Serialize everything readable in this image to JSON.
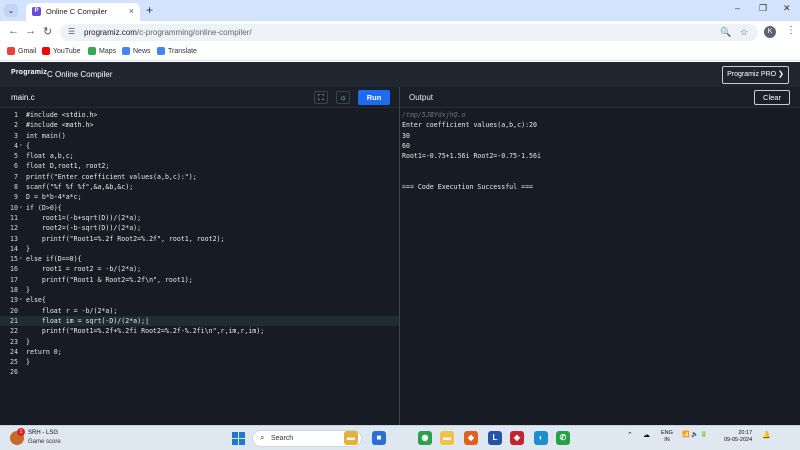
{
  "browser": {
    "tab_menu_icon": "chevron-down-icon",
    "tab_title": "Online C Compiler",
    "tab_close": "×",
    "new_tab": "+",
    "window_controls": [
      "–",
      "❐",
      "✕"
    ],
    "back": "←",
    "forward": "→",
    "reload": "↻",
    "url_host": "programiz.com",
    "url_path": "/c-programming/online-compiler/",
    "zoom_icon": "🔍",
    "star_icon": "☆",
    "profile_letter": "K",
    "menu_icon": "⋮",
    "bookmarks": [
      {
        "label": "Gmail",
        "color": "#ea4335"
      },
      {
        "label": "YouTube",
        "color": "#ff0000"
      },
      {
        "label": "Maps",
        "color": "#34a853"
      },
      {
        "label": "News",
        "color": "#4285f4"
      },
      {
        "label": "Translate",
        "color": "#4285f4"
      }
    ]
  },
  "site": {
    "logo": "Programiz",
    "title": "C Online Compiler",
    "pro_button": "Programiz PRO ❯"
  },
  "editor": {
    "file_tab": "main.c",
    "fullscreen_icon": "⛶",
    "theme_icon": "☼",
    "run_label": "Run",
    "active_line": 21,
    "lines": [
      {
        "n": "1",
        "fold": "",
        "code": "#include <stdio.h>"
      },
      {
        "n": "2",
        "fold": "",
        "code": "#include <math.h>"
      },
      {
        "n": "3",
        "fold": "",
        "code": "int main()"
      },
      {
        "n": "4",
        "fold": "▾",
        "code": "{"
      },
      {
        "n": "5",
        "fold": "",
        "code": "float a,b,c;"
      },
      {
        "n": "6",
        "fold": "",
        "code": "float D,root1, root2;"
      },
      {
        "n": "7",
        "fold": "",
        "code": "printf(\"Enter coefficient values(a,b,c):\");"
      },
      {
        "n": "8",
        "fold": "",
        "code": "scanf(\"%f %f %f\",&a,&b,&c);"
      },
      {
        "n": "9",
        "fold": "",
        "code": "D = b*b-4*a*c;"
      },
      {
        "n": "10",
        "fold": "▾",
        "code": "if (D>0){"
      },
      {
        "n": "11",
        "fold": "",
        "code": "    root1=(-b+sqrt(D))/(2*a);"
      },
      {
        "n": "12",
        "fold": "",
        "code": "    root2=(-b-sqrt(D))/(2*a);"
      },
      {
        "n": "13",
        "fold": "",
        "code": "    printf(\"Root1=%.2f Root2=%.2f\", root1, root2);"
      },
      {
        "n": "14",
        "fold": "",
        "code": "}"
      },
      {
        "n": "15",
        "fold": "▾",
        "code": "else if(D==0){"
      },
      {
        "n": "16",
        "fold": "",
        "code": "    root1 = root2 = -b/(2*a);"
      },
      {
        "n": "17",
        "fold": "",
        "code": "    printf(\"Root1 & Root2=%.2f\\n\", root1);"
      },
      {
        "n": "18",
        "fold": "",
        "code": "}"
      },
      {
        "n": "19",
        "fold": "▾",
        "code": "else{"
      },
      {
        "n": "20",
        "fold": "",
        "code": "    float r = -b/(2*a);"
      },
      {
        "n": "21",
        "fold": "",
        "code": "    float im = sqrt(-D)/(2*a);|"
      },
      {
        "n": "22",
        "fold": "",
        "code": "    printf(\"Root1=%.2f+%.2fi Root2=%.2f-%.2fi\\n\",r,im,r,im);"
      },
      {
        "n": "23",
        "fold": "",
        "code": "}"
      },
      {
        "n": "24",
        "fold": "",
        "code": "return 0;"
      },
      {
        "n": "25",
        "fold": "",
        "code": "}"
      },
      {
        "n": "26",
        "fold": "",
        "code": ""
      }
    ]
  },
  "output": {
    "title": "Output",
    "clear_label": "Clear",
    "lines": [
      {
        "text": "/tmp/5JBYdxjhQ.o",
        "kind": "path"
      },
      {
        "text": "Enter coefficient values(a,b,c):20",
        "kind": "text"
      },
      {
        "text": "30",
        "kind": "text"
      },
      {
        "text": "60",
        "kind": "text"
      },
      {
        "text": "Root1=-0.75+1.56i Root2=-0.75-1.56i",
        "kind": "text"
      },
      {
        "text": "",
        "kind": "text"
      },
      {
        "text": "",
        "kind": "text"
      },
      {
        "text": "=== Code Execution Successful ===",
        "kind": "text"
      }
    ]
  },
  "taskbar": {
    "widget_badge": "1",
    "widget_title": "SRH - LSG",
    "widget_subtitle": "Game score",
    "search_icon": "⌕",
    "search_label": "Search",
    "apps": [
      {
        "name": "file-explorer-icon",
        "glyph": "▬",
        "color": "#e8b03a"
      },
      {
        "name": "store-icon",
        "glyph": "■",
        "color": "#2a6fd6"
      },
      {
        "name": "chrome-icon",
        "glyph": "◉",
        "color": "#2f9e4f"
      },
      {
        "name": "folder-icon",
        "glyph": "▬",
        "color": "#f2c14a"
      },
      {
        "name": "office-icon",
        "glyph": "◆",
        "color": "#e0601f"
      },
      {
        "name": "lens-icon",
        "glyph": "L",
        "color": "#2454a6"
      },
      {
        "name": "shield-icon",
        "glyph": "◈",
        "color": "#c0262d"
      },
      {
        "name": "edge-icon",
        "glyph": "◐",
        "color": "#1b8fd0"
      },
      {
        "name": "whatsapp-icon",
        "glyph": "✆",
        "color": "#25a244"
      }
    ],
    "tray_chevron": "⌃",
    "tray_cloud": "☁",
    "lang_top": "ENG",
    "lang_bottom": "IN",
    "tray_icons": "📶 🔈 🔋",
    "time": "20:17",
    "date": "09-05-2024",
    "bell": "🔔"
  }
}
